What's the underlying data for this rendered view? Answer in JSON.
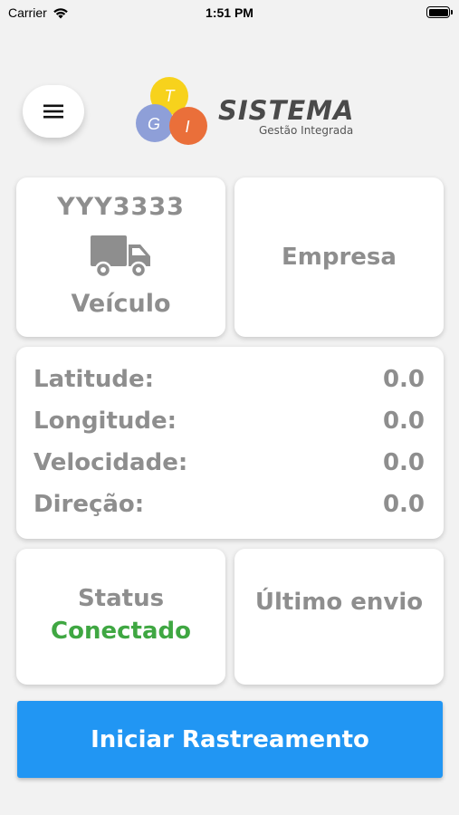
{
  "status_bar": {
    "carrier": "Carrier",
    "time": "1:51 PM",
    "wifi_icon": "wifi-icon",
    "battery_icon": "battery-icon"
  },
  "header": {
    "menu_icon": "hamburger-menu-icon",
    "logo": {
      "bubble_letters": [
        "T",
        "G",
        "I"
      ],
      "title": "SISTEMA",
      "subtitle": "Gestão Integrada",
      "colors": {
        "yellow": "#f7d21c",
        "blue": "#8e9fd8",
        "orange": "#ea6f3a",
        "title": "#4a4a4a"
      }
    }
  },
  "vehicle_card": {
    "plate": "YYY3333",
    "icon": "truck-icon",
    "label": "Veículo"
  },
  "company_card": {
    "label": "Empresa"
  },
  "coordinates": {
    "rows": [
      {
        "label": "Latitude:",
        "value": "0.0"
      },
      {
        "label": "Longitude:",
        "value": "0.0"
      },
      {
        "label": "Velocidade:",
        "value": "0.0"
      },
      {
        "label": "Direção:",
        "value": "0.0"
      }
    ]
  },
  "status_card": {
    "title": "Status",
    "value": "Conectado"
  },
  "last_send_card": {
    "title": "Último envio"
  },
  "action": {
    "label": "Iniciar Rastreamento"
  },
  "colors": {
    "background": "#f2f2f2",
    "card_text": "#8e8e8e",
    "status_ok": "#3fa742",
    "primary_button": "#2196f3"
  }
}
